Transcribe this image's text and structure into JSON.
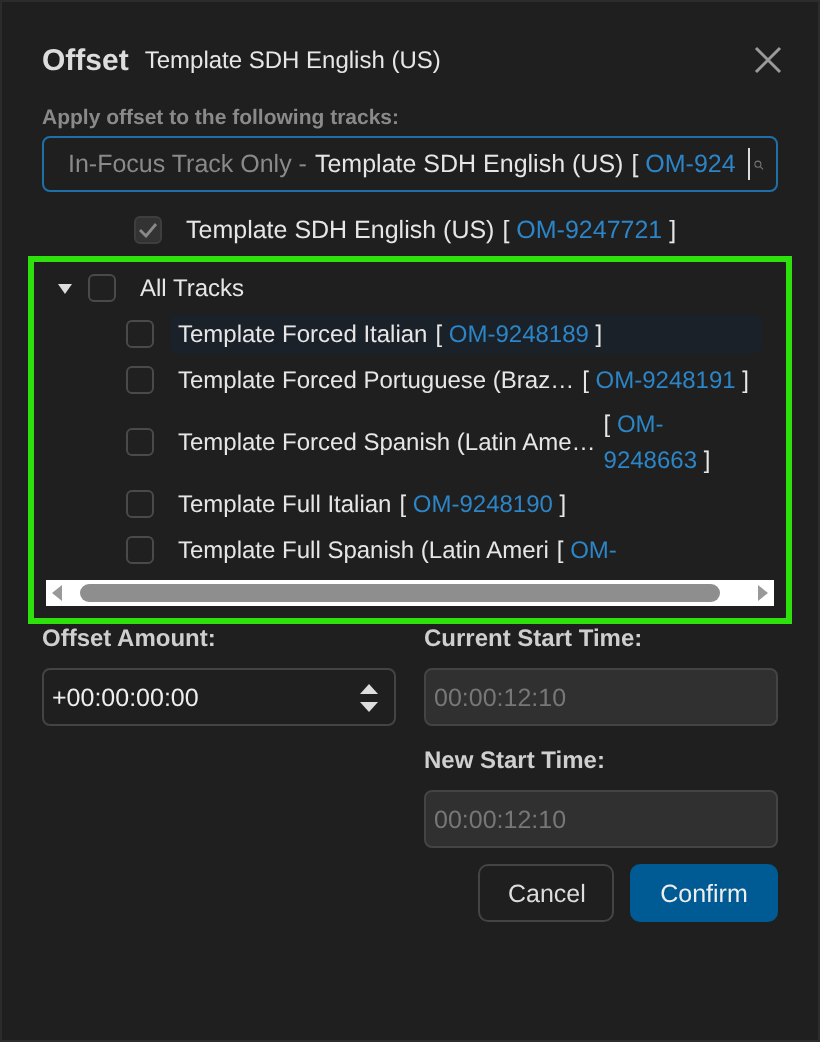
{
  "dialog": {
    "title": "Offset",
    "subtitle": "Template SDH English (US)"
  },
  "tracks_label": "Apply offset to the following tracks:",
  "search": {
    "prefix": "In-Focus Track Only -",
    "name": "Template SDH English (US)",
    "ref_open": "[",
    "ref_id": "OM-924"
  },
  "in_focus_track": {
    "name": "Template SDH English (US)",
    "ref_open": "[",
    "ref_id": "OM-9247721",
    "ref_close": "]",
    "checked": true,
    "disabled": true
  },
  "tree": {
    "label": "All Tracks",
    "expanded": true,
    "checked": false,
    "children": [
      {
        "name": "Template Forced Italian",
        "ref_open": "[",
        "ref_id": "OM-9248189",
        "ref_close": "]",
        "checked": false,
        "highlighted": true
      },
      {
        "name": "Template Forced Portuguese (Braz…",
        "ref_open": "[",
        "ref_id": "OM-9248191",
        "ref_close": "]",
        "checked": false,
        "highlighted": false
      },
      {
        "name": "Template Forced Spanish (Latin Ame…",
        "ref_open": "[",
        "ref_id": "OM-9248663",
        "ref_close": "]",
        "checked": false,
        "highlighted": false
      },
      {
        "name": "Template Full Italian",
        "ref_open": "[",
        "ref_id": "OM-9248190",
        "ref_close": "]",
        "checked": false,
        "highlighted": false
      },
      {
        "name": "Template Full Spanish (Latin Ameri",
        "ref_open": "[",
        "ref_id": "OM-",
        "checked": false,
        "highlighted": false
      }
    ]
  },
  "offset_amount": {
    "label": "Offset Amount:",
    "value": "+00:00:00:00"
  },
  "current_start": {
    "label": "Current Start Time:",
    "value": "00:00:12:10",
    "disabled": true
  },
  "new_start": {
    "label": "New Start Time:",
    "value": "00:00:12:10",
    "disabled": true
  },
  "buttons": [
    {
      "label": "Cancel",
      "kind": "secondary"
    },
    {
      "label": "Confirm",
      "kind": "primary"
    }
  ]
}
